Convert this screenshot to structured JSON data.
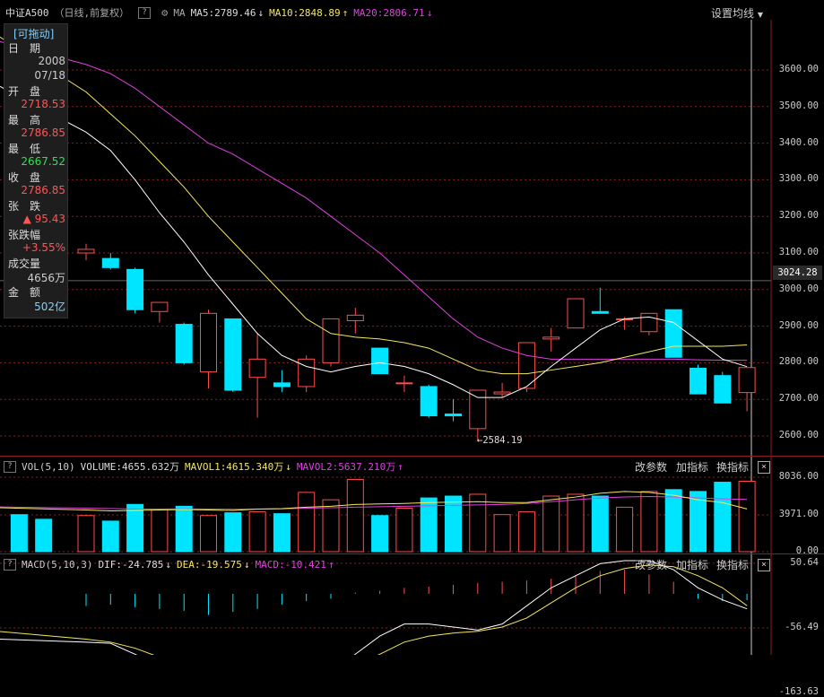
{
  "header": {
    "symbol": "中证A500",
    "mode": "（日线,前复权）",
    "help": "?",
    "gear_icon": "gear-icon",
    "ma_label": "MA",
    "ma5": "MA5:2789.46",
    "ma10": "MA10:2848.89",
    "ma20": "MA20:2806.71",
    "settings": "设置均线"
  },
  "info_box": {
    "title": "[可拖动]",
    "date_label": "日　期",
    "date_year": "2008",
    "date_md": "07/18",
    "open_label": "开　盘",
    "open": "2718.53",
    "high_label": "最　高",
    "high": "2786.85",
    "low_label": "最　低",
    "low": "2667.52",
    "close_label": "收　盘",
    "close": "2786.85",
    "change_label": "张　跌",
    "change": "▲ 95.43",
    "pct_label": "张跌幅",
    "pct": "+3.55%",
    "vol_label": "成交量",
    "volume": "4656万",
    "amount_label": "金　额",
    "amount": "502亿"
  },
  "price_axis": {
    "ticks": [
      "3600.00",
      "3500.00",
      "3400.00",
      "3300.00",
      "3200.00",
      "3100.00",
      "3000.00",
      "2900.00",
      "2800.00",
      "2700.00",
      "2600.00"
    ],
    "current": "3024.28",
    "low_marker": "2584.19"
  },
  "vol_panel": {
    "title": "VOL(5,10)",
    "volume": "VOLUME:4655.632万",
    "mavol1": "MAVOL1:4615.340万",
    "mavol2": "MAVOL2:5637.210万",
    "ticks": [
      "8036.00",
      "3971.00",
      "0.00"
    ],
    "btn_params": "改参数",
    "btn_add": "加指标",
    "btn_switch": "换指标",
    "close": "×"
  },
  "macd_panel": {
    "title": "MACD(5,10,3)",
    "dif": "DIF:-24.785",
    "dea": "DEA:-19.575",
    "macd": "MACD:-10.421",
    "ticks": [
      "50.64",
      "-56.49",
      "-163.63"
    ],
    "btn_params": "改参数",
    "btn_add": "加指标",
    "btn_switch": "换指标",
    "close": "×"
  },
  "colors": {
    "up": "#ff4d4d",
    "down": "#00e5ff",
    "ma5": "#ffffff",
    "ma10": "#f5e85a",
    "ma20": "#e040e0",
    "grid": "#8b1e1e"
  },
  "candles": [
    [
      3100,
      3125,
      3080,
      3110
    ],
    [
      3085,
      3100,
      3055,
      3060
    ],
    [
      3055,
      3060,
      2935,
      2945
    ],
    [
      2940,
      2955,
      2910,
      2965
    ],
    [
      2905,
      2910,
      2795,
      2800
    ],
    [
      2775,
      2945,
      2730,
      2935
    ],
    [
      2920,
      2920,
      2720,
      2725
    ],
    [
      2760,
      2880,
      2650,
      2810
    ],
    [
      2745,
      2780,
      2720,
      2735
    ],
    [
      2735,
      2820,
      2720,
      2810
    ],
    [
      2800,
      2920,
      2790,
      2920
    ],
    [
      2915,
      2950,
      2880,
      2930
    ],
    [
      2840,
      2840,
      2770,
      2770
    ],
    [
      2745,
      2765,
      2720,
      2745
    ],
    [
      2735,
      2740,
      2650,
      2655
    ],
    [
      2660,
      2700,
      2640,
      2655
    ],
    [
      2620,
      2725,
      2585,
      2725
    ],
    [
      2715,
      2745,
      2705,
      2720
    ],
    [
      2730,
      2850,
      2720,
      2855
    ],
    [
      2865,
      2895,
      2830,
      2870
    ],
    [
      2895,
      2975,
      2895,
      2975
    ],
    [
      2940,
      3005,
      2935,
      2935
    ],
    [
      2920,
      2925,
      2890,
      2920
    ],
    [
      2885,
      2935,
      2875,
      2935
    ],
    [
      2945,
      2945,
      2820,
      2815
    ],
    [
      2785,
      2795,
      2715,
      2715
    ],
    [
      2765,
      2775,
      2690,
      2690
    ],
    [
      2718.53,
      2786.85,
      2667.52,
      2786.85
    ]
  ],
  "ma5": [
    3430,
    3380,
    3300,
    3210,
    3130,
    3040,
    2960,
    2880,
    2820,
    2790,
    2775,
    2790,
    2800,
    2790,
    2770,
    2740,
    2705,
    2705,
    2735,
    2790,
    2840,
    2890,
    2920,
    2925,
    2910,
    2860,
    2810,
    2789.46
  ],
  "ma10": [
    3540,
    3480,
    3420,
    3350,
    3280,
    3200,
    3130,
    3060,
    2990,
    2920,
    2880,
    2870,
    2865,
    2855,
    2840,
    2810,
    2780,
    2770,
    2770,
    2780,
    2790,
    2800,
    2815,
    2830,
    2845,
    2845,
    2845,
    2848.89
  ],
  "ma20": [
    3615,
    3590,
    3550,
    3500,
    3450,
    3400,
    3370,
    3330,
    3290,
    3250,
    3200,
    3150,
    3100,
    3040,
    2980,
    2920,
    2870,
    2840,
    2820,
    2810,
    2810,
    2810,
    2810,
    2810,
    2810,
    2808,
    2807,
    2806.71
  ],
  "vol": [
    3900,
    3300,
    5100,
    4600,
    4900,
    3900,
    4200,
    4300,
    4100,
    6400,
    5600,
    7800,
    3900,
    4700,
    5800,
    6000,
    6200,
    4000,
    4300,
    6000,
    6200,
    6000,
    4800,
    6500,
    6700,
    6500,
    7500,
    7600
  ],
  "mavol1": [
    4500,
    4400,
    4450,
    4500,
    4550,
    4500,
    4450,
    4600,
    4650,
    4800,
    4900,
    5100,
    5150,
    5200,
    5300,
    5350,
    5400,
    5300,
    5300,
    5600,
    5900,
    6300,
    6500,
    6400,
    6100,
    5600,
    5300,
    4615.34
  ],
  "mavol2": [
    4700,
    4650,
    4600,
    4600,
    4620,
    4600,
    4580,
    4600,
    4620,
    4700,
    4750,
    4800,
    4850,
    4900,
    4950,
    5000,
    5050,
    5100,
    5200,
    5400,
    5600,
    5800,
    5900,
    5950,
    5900,
    5800,
    5700,
    5637.21
  ],
  "macd_hist": [
    -20,
    -18,
    -22,
    -25,
    -28,
    -35,
    -30,
    -25,
    -18,
    -12,
    -8,
    2,
    5,
    10,
    12,
    15,
    18,
    20,
    22,
    25,
    30,
    38,
    40,
    32,
    20,
    -8,
    -12,
    -10.42
  ],
  "dif": [
    -80,
    -82,
    -100,
    -120,
    -130,
    -140,
    -150,
    -145,
    -145,
    -140,
    -130,
    -100,
    -70,
    -50,
    -50,
    -55,
    -60,
    -50,
    -20,
    10,
    30,
    50,
    55,
    55,
    40,
    10,
    -10,
    -24.785
  ],
  "dea": [
    -75,
    -80,
    -90,
    -105,
    -115,
    -125,
    -135,
    -138,
    -140,
    -140,
    -135,
    -120,
    -100,
    -80,
    -70,
    -65,
    -62,
    -55,
    -40,
    -15,
    10,
    30,
    42,
    48,
    45,
    30,
    10,
    -19.575
  ]
}
